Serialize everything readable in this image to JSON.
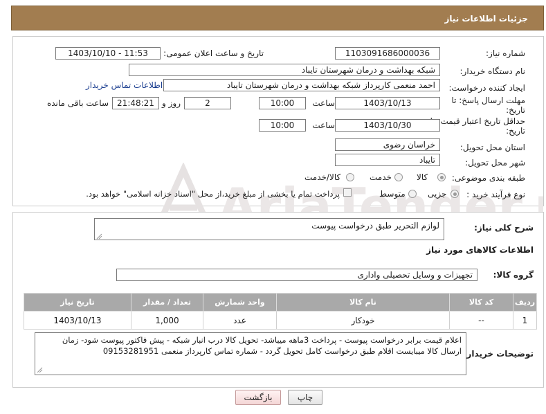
{
  "header": {
    "title": "جزئیات اطلاعات نیاز"
  },
  "form": {
    "need_number_label": "شماره نیاز:",
    "need_number": "1103091686000036",
    "announce_label": "تاریخ و ساعت اعلان عمومی:",
    "announce_value": "1403/10/10 - 11:53",
    "buyer_org_label": "نام دستگاه خریدار:",
    "buyer_org": "شبکه بهداشت و درمان شهرستان تایباد",
    "creator_label": "ایجاد کننده درخواست:",
    "creator": "احمد منعمی کارپرداز شبکه بهداشت و درمان شهرستان تایباد",
    "contact_link": "اطلاعات تماس خریدار",
    "deadline_label_1": "مهلت ارسال پاسخ: تا",
    "deadline_label_2": "تاریخ:",
    "deadline_date": "1403/10/13",
    "time_label": "ساعت",
    "deadline_time": "10:00",
    "days_value": "2",
    "days_label": "روز و",
    "remaining_time": "21:48:21",
    "remaining_label": "ساعت باقی مانده",
    "validity_label_1": "حداقل تاریخ اعتبار قیمت: تا",
    "validity_label_2": "تاریخ:",
    "validity_date": "1403/10/30",
    "validity_time": "10:00",
    "province_label": "استان محل تحویل:",
    "province": "خراسان رضوی",
    "city_label": "شهر محل تحویل:",
    "city": "تایباد",
    "category_label": "طبقه بندی موضوعی:",
    "category_options": [
      "کالا",
      "خدمت",
      "کالا/خدمت"
    ],
    "category_selected": "کالا",
    "purchase_type_label": "نوع فرآیند خرید :",
    "purchase_options": [
      "جزیی",
      "متوسط"
    ],
    "purchase_selected": "جزیی",
    "payment_note": "پرداخت تمام یا بخشی از مبلغ خرید،از محل \"اسناد خزانه اسلامی\" خواهد بود."
  },
  "summary": {
    "label": "شرح کلی نیاز:",
    "value": "لوازم التحریر طبق درخواست پیوست"
  },
  "goods_section": {
    "title": "اطلاعات کالاهای مورد نیاز",
    "group_label": "گروه کالا:",
    "group_value": "تجهیزات و وسایل تحصیلی واداری"
  },
  "table": {
    "headers": [
      "ردیف",
      "کد کالا",
      "نام کالا",
      "واحد شمارش",
      "تعداد / مقدار",
      "تاریخ نیاز"
    ],
    "rows": [
      {
        "row": "1",
        "code": "--",
        "name": "خودکار",
        "unit": "عدد",
        "qty": "1,000",
        "date": "1403/10/13"
      }
    ]
  },
  "buyer_notes": {
    "label": "توضیحات خریدار:",
    "line1": "اعلام قیمت برابر درخواست پیوست  - پرداخت 3ماهه میباشد- تحویل کالا درب انبار شبکه - پیش فاکتور پیوست شود- زمان",
    "line2": "ارسال کالا میبایست اقلام طبق درخواست  کامل تحویل گردد - شماره تماس کارپرداز منعمی 09153281951"
  },
  "buttons": {
    "print": "چاپ",
    "back": "بازگشت"
  },
  "watermark": {
    "text": "AriaTender.net",
    "color": "#e8e4e4"
  },
  "colors": {
    "header": "#a27d50",
    "table_header": "#a9a9a9",
    "link": "#1a3d8f"
  }
}
